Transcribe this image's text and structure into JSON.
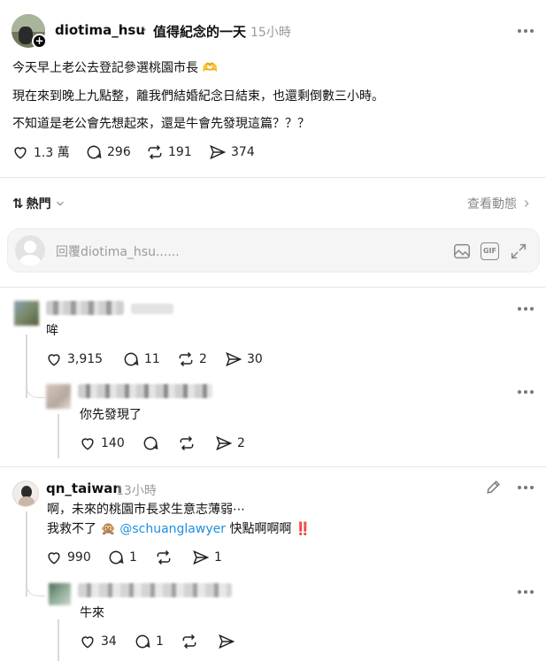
{
  "post": {
    "username": "diotima_hsu",
    "separator": "›",
    "topic": "值得紀念的一天",
    "time": "15小時",
    "lines": [
      "今天早上老公去登記參選桃園市長 🫶",
      "現在來到晚上九點整，離我們結婚紀念日結束，也還剩倒數三小時。",
      "不知道是老公會先想起來，還是牛會先發現這篇？？？"
    ],
    "likes": "1.3 萬",
    "comments": "296",
    "reposts": "191",
    "shares": "374"
  },
  "sort": {
    "label": "熱門",
    "view_activity": "查看動態"
  },
  "reply_box": {
    "placeholder": "回覆diotima_hsu......"
  },
  "replies": [
    {
      "text": "哞",
      "likes": "3,915",
      "comments": "11",
      "reposts": "2",
      "shares": "30",
      "nested": {
        "text": "你先發現了",
        "likes": "140",
        "comments": "",
        "reposts": "",
        "shares": "2"
      }
    },
    {
      "username": "qn_taiwan",
      "time": "13小時",
      "line1": "啊，未來的桃園市長求生意志薄弱⋯",
      "line2_prefix": "我救不了",
      "line2_emoji": "🙊",
      "mention": "@schuanglawyer",
      "line2_suffix": "快點啊啊啊",
      "line2_emoji_end": "‼️",
      "likes": "990",
      "comments": "1",
      "reposts": "",
      "shares": "1",
      "nested": {
        "text": "牛來",
        "likes": "34",
        "comments": "1",
        "reposts": "",
        "shares": ""
      }
    }
  ],
  "colors": {
    "mention": "#1d8fe0",
    "muted": "#9a9a9a",
    "divider": "#e6e6e6"
  }
}
